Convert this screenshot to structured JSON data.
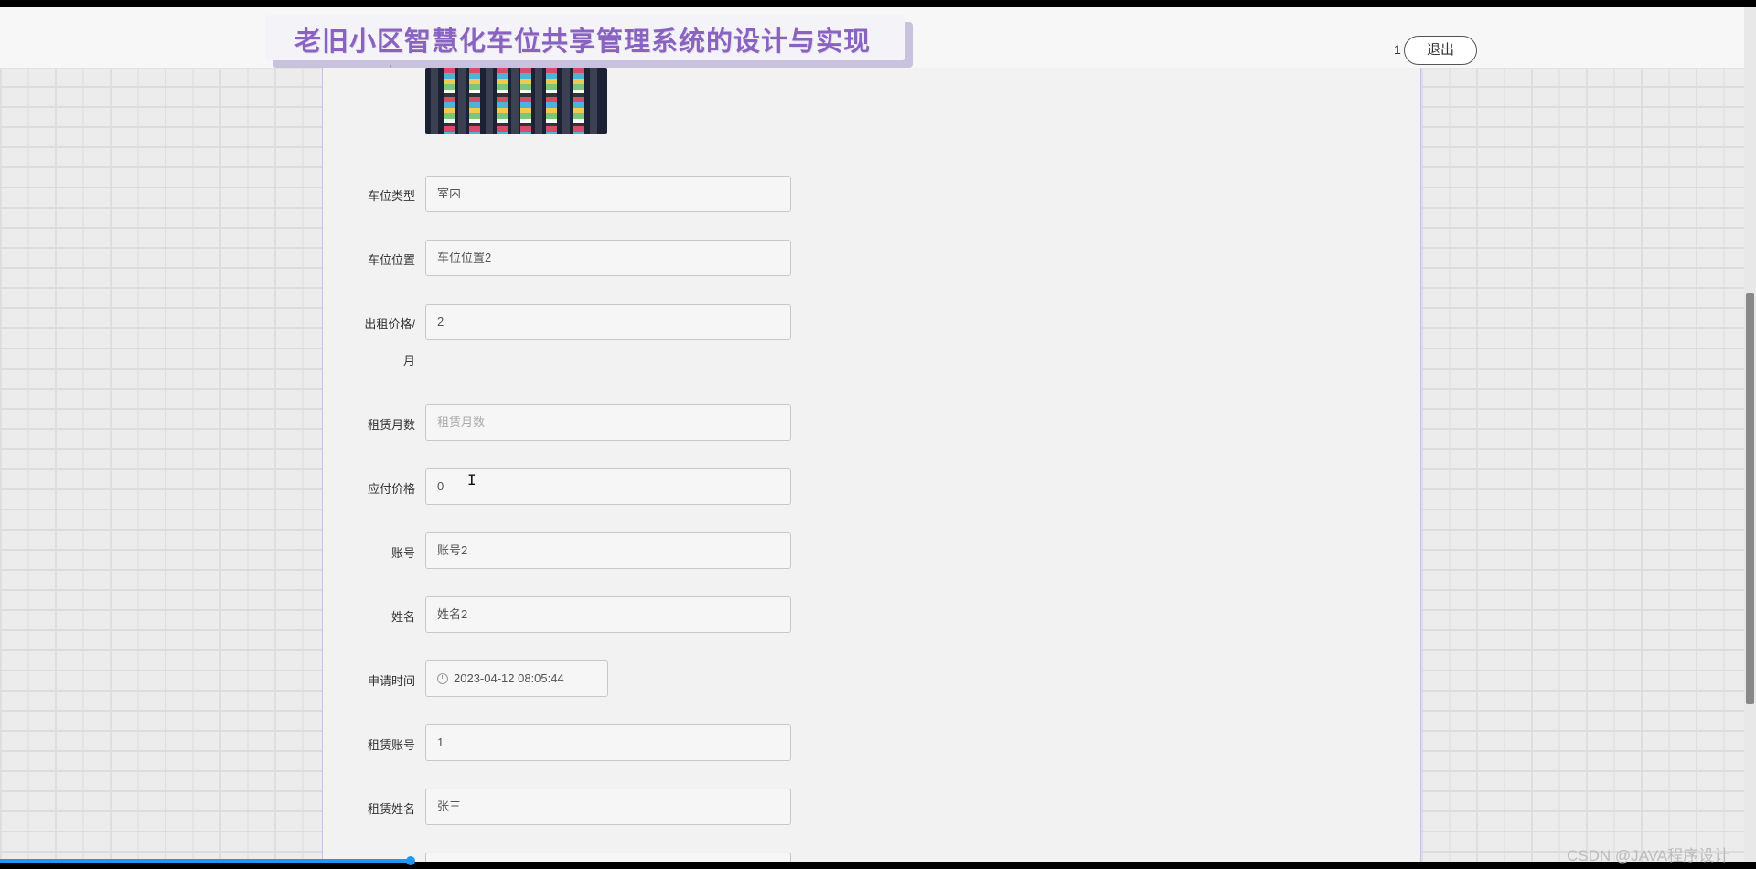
{
  "header": {
    "title": "老旧小区智慧化车位共享管理系统的设计与实现",
    "user_number": "1",
    "logout_label": "退出"
  },
  "form": {
    "fields": [
      {
        "label": "车位类型",
        "value": "室内",
        "placeholder": false
      },
      {
        "label": "车位位置",
        "value": "车位位置2",
        "placeholder": false
      },
      {
        "label": "出租价格/",
        "label2": "月",
        "value": "2",
        "placeholder": false
      },
      {
        "label": "租赁月数",
        "value": "租赁月数",
        "placeholder": true
      },
      {
        "label": "应付价格",
        "value": "0",
        "placeholder": false
      },
      {
        "label": "账号",
        "value": "账号2",
        "placeholder": false
      },
      {
        "label": "姓名",
        "value": "姓名2",
        "placeholder": false
      },
      {
        "label": "申请时间",
        "value": "2023-04-12 08:05:44",
        "placeholder": false
      },
      {
        "label": "租赁账号",
        "value": "1",
        "placeholder": false
      },
      {
        "label": "租赁姓名",
        "value": "张三",
        "placeholder": false
      }
    ]
  },
  "watermark": "CSDN @JAVA程序设计",
  "colors": {
    "title": "#8a63c2",
    "title_shadow_box": "#c9c2de",
    "progress": "#2196f3"
  }
}
